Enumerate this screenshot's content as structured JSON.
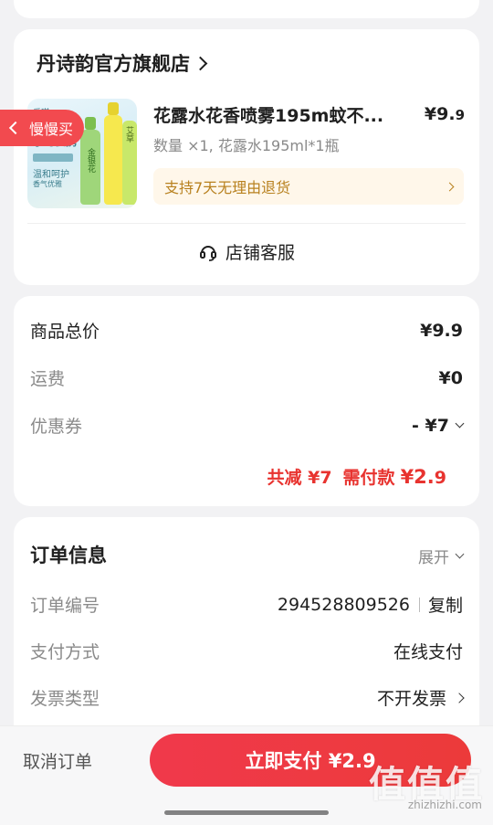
{
  "shop": {
    "name": "丹诗韵官方旗舰店",
    "slow_buy_badge": "慢慢买",
    "product": {
      "title": "花露水花香喷雾195m蚊不...",
      "price_main": "¥9.",
      "price_decimal": "9",
      "spec": "数量 ×1, 花露水195ml*1瓶",
      "return_policy": "支持7天无理由退货",
      "image_texts": [
        "爱琪",
        "小巧便携",
        "温和呵护",
        "香气优雅",
        "金银花",
        "艾草"
      ]
    },
    "customer_service": "店铺客服"
  },
  "price": {
    "goods_total_label": "商品总价",
    "goods_total_value": "¥9.9",
    "shipping_label": "运费",
    "shipping_value": "¥0",
    "coupon_label": "优惠券",
    "coupon_value": "- ¥7",
    "discount_text": "共减 ¥7",
    "pay_label": "需付款",
    "pay_main": "¥2.",
    "pay_decimal": "9"
  },
  "order": {
    "title": "订单信息",
    "expand_label": "展开",
    "number_label": "订单编号",
    "number_value": "294528809526",
    "copy_label": "复制",
    "payment_label": "支付方式",
    "payment_value": "在线支付",
    "invoice_label": "发票类型",
    "invoice_value": "不开发票"
  },
  "footer": {
    "cancel_label": "取消订单",
    "pay_now_label": "立即支付 ¥2.9"
  },
  "watermark": {
    "main": "值值值",
    "sub": "zhizhizhi.com"
  },
  "colors": {
    "accent": "#e8332f",
    "return_bg": "#fff7ea",
    "return_text": "#b8811f"
  }
}
